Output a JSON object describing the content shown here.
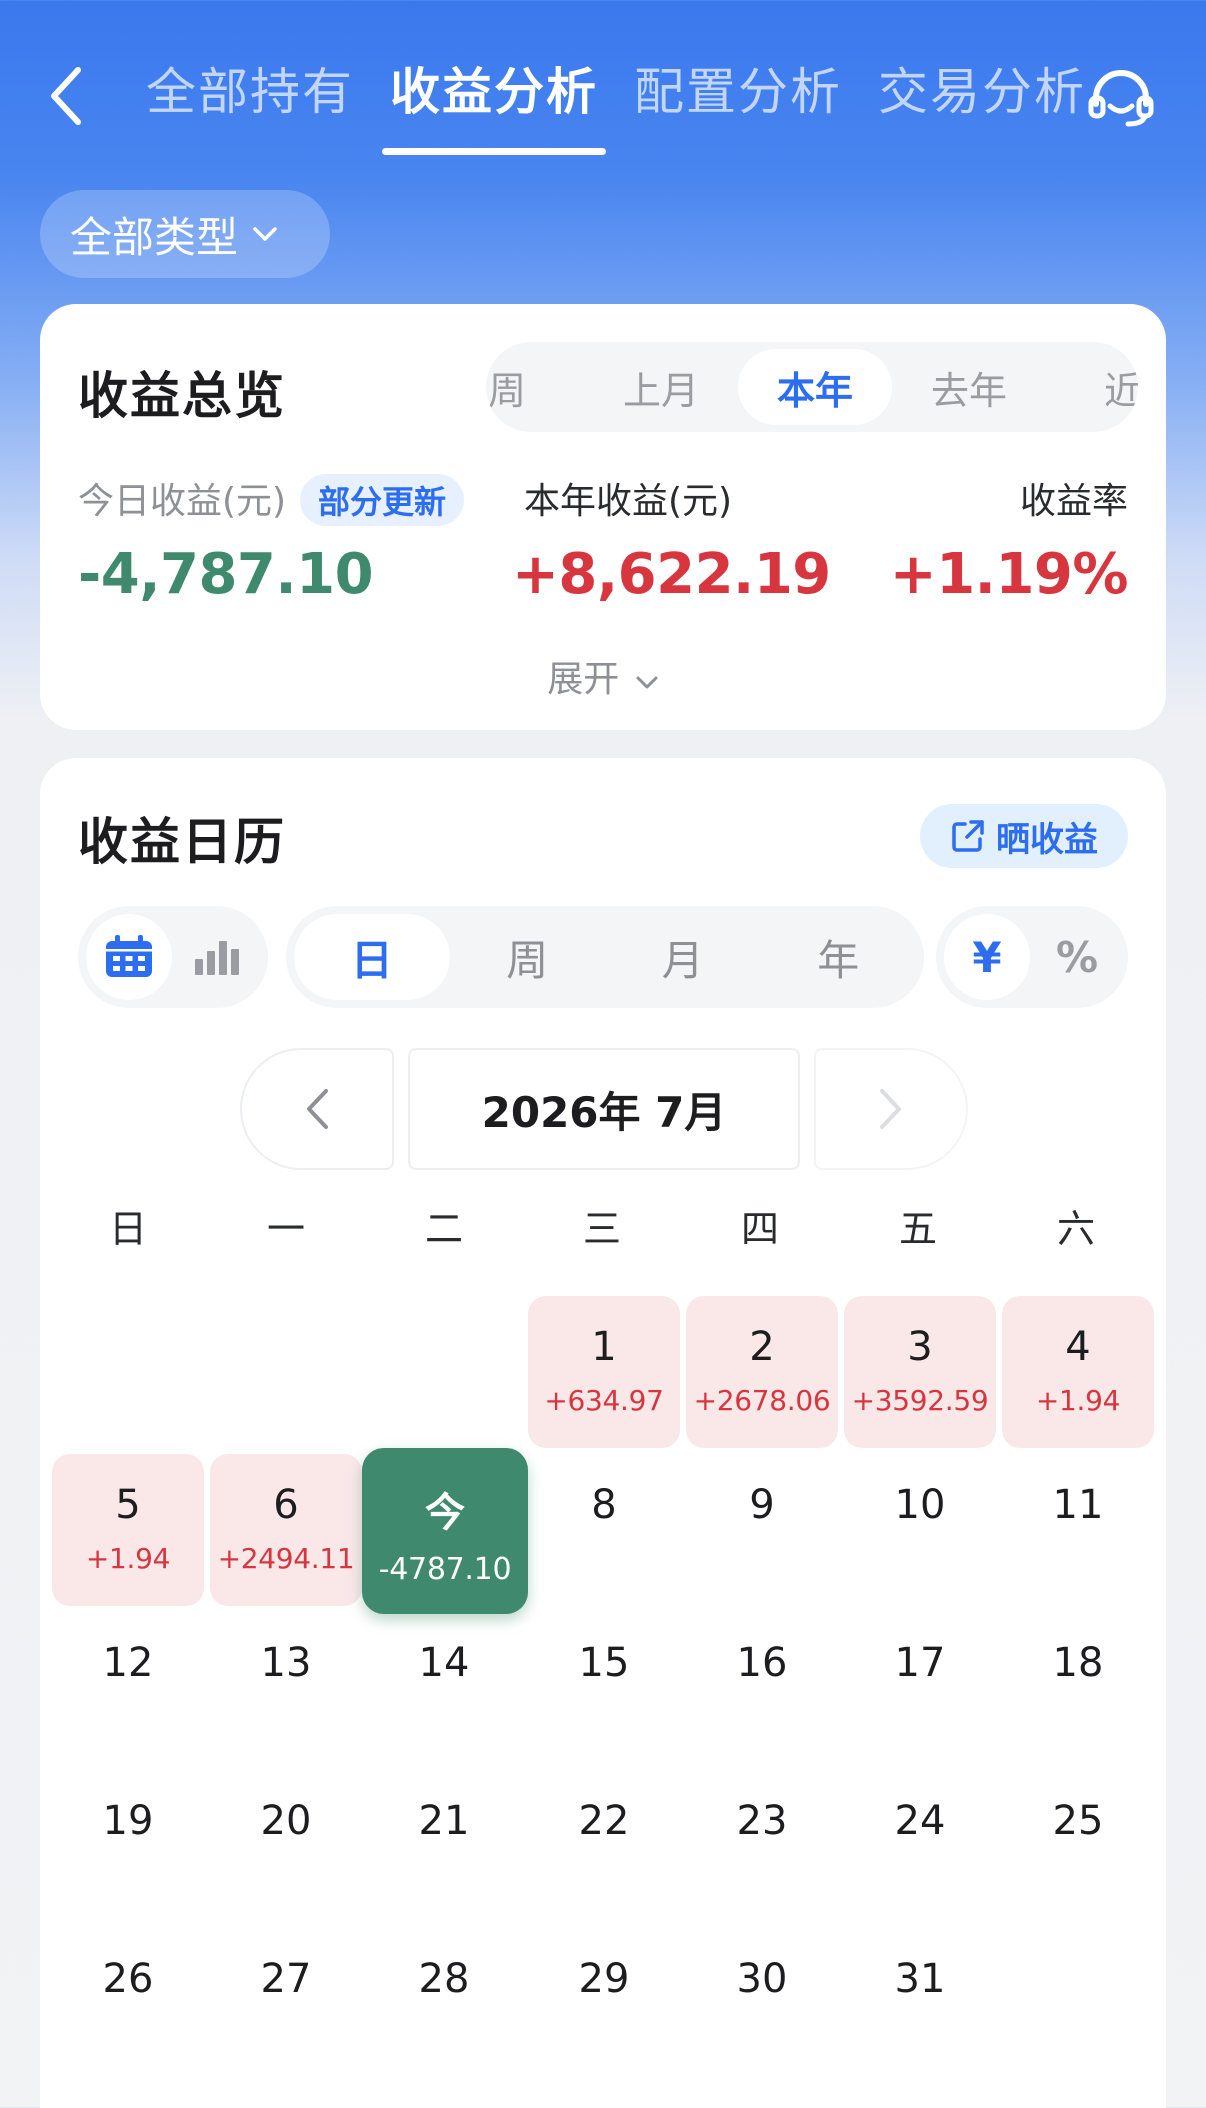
{
  "nav": {
    "tabs": [
      {
        "label": "全部持有"
      },
      {
        "label": "收益分析"
      },
      {
        "label": "配置分析"
      },
      {
        "label": "交易分析"
      }
    ]
  },
  "filter": {
    "label": "全部类型"
  },
  "overview": {
    "title": "收益总览",
    "periods": [
      "周",
      "上月",
      "本年",
      "去年",
      "近"
    ],
    "active_period": "本年",
    "today_label": "今日收益(元)",
    "update_badge": "部分更新",
    "today_value": "-4,787.10",
    "year_label": "本年收益(元)",
    "year_value": "+8,622.19",
    "rate_label": "收益率",
    "rate_value": "+1.19%",
    "expand_label": "展开"
  },
  "calendar": {
    "title": "收益日历",
    "share_label": "晒收益",
    "granularity": [
      "日",
      "周",
      "月",
      "年"
    ],
    "units": [
      "¥",
      "%"
    ],
    "month_label": "2026年 7月",
    "weekdays": [
      "日",
      "一",
      "二",
      "三",
      "四",
      "五",
      "六"
    ],
    "days": [
      {
        "num": "1",
        "value": "+634.97"
      },
      {
        "num": "2",
        "value": "+2678.06"
      },
      {
        "num": "3",
        "value": "+3592.59"
      },
      {
        "num": "4",
        "value": "+1.94"
      },
      {
        "num": "5",
        "value": "+1.94"
      },
      {
        "num": "6",
        "value": "+2494.11"
      },
      {
        "num": "今",
        "value": "-4787.10"
      },
      {
        "num": "8"
      },
      {
        "num": "9"
      },
      {
        "num": "10"
      },
      {
        "num": "11"
      },
      {
        "num": "12"
      },
      {
        "num": "13"
      },
      {
        "num": "14"
      },
      {
        "num": "15"
      },
      {
        "num": "16"
      },
      {
        "num": "17"
      },
      {
        "num": "18"
      },
      {
        "num": "19"
      },
      {
        "num": "20"
      },
      {
        "num": "21"
      },
      {
        "num": "22"
      },
      {
        "num": "23"
      },
      {
        "num": "24"
      },
      {
        "num": "25"
      },
      {
        "num": "26"
      },
      {
        "num": "27"
      },
      {
        "num": "28"
      },
      {
        "num": "29"
      },
      {
        "num": "30"
      },
      {
        "num": "31"
      }
    ]
  },
  "colors": {
    "brand_blue": "#2d6df0",
    "gain_red": "#d8363f",
    "loss_green": "#3f8a6e",
    "gain_cell_bg": "#fae8e9"
  }
}
